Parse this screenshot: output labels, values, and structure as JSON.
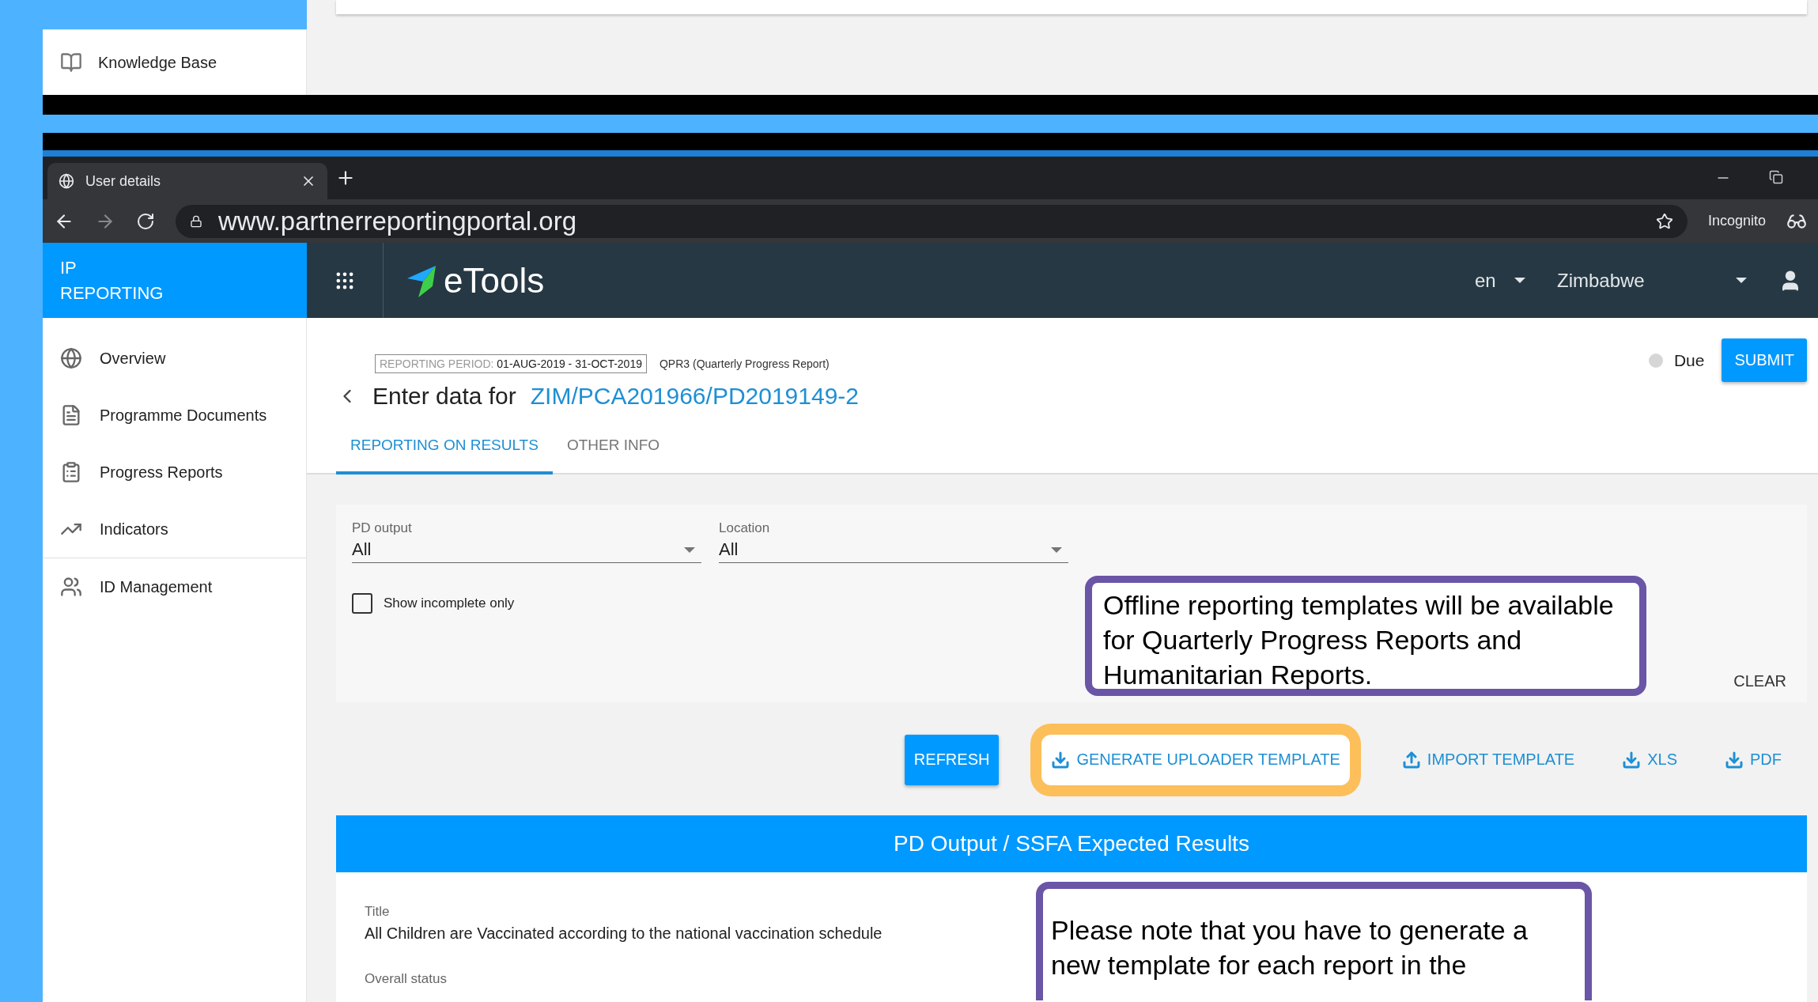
{
  "background_window": {
    "sidebar_items": [
      {
        "label": "Knowledge Base"
      }
    ]
  },
  "browser": {
    "tab": {
      "title": "User details"
    },
    "url": "www.partnerreportingportal.org",
    "profile": "Incognito"
  },
  "app_header": {
    "brand_line_1": "IP",
    "brand_line_2": "REPORTING",
    "logo": "eTools",
    "language": "en",
    "country": "Zimbabwe"
  },
  "sidebar": {
    "items": [
      {
        "label": "Overview"
      },
      {
        "label": "Programme Documents"
      },
      {
        "label": "Progress Reports"
      },
      {
        "label": "Indicators"
      }
    ],
    "secondary_items": [
      {
        "label": "ID Management"
      }
    ]
  },
  "report": {
    "period_label": "REPORTING PERIOD:",
    "period": "01-AUG-2019 - 31-OCT-2019",
    "report_type": "QPR3 (Quarterly Progress Report)",
    "title_prefix": "Enter data for",
    "reference": "ZIM/PCA201966/PD2019149-2",
    "status": "Due",
    "submit": "SUBMIT"
  },
  "tabs": [
    {
      "label": "REPORTING ON RESULTS",
      "selected": true
    },
    {
      "label": "OTHER INFO",
      "selected": false
    }
  ],
  "filters": {
    "fields": [
      {
        "label": "PD output",
        "value": "All"
      },
      {
        "label": "Location",
        "value": "All"
      }
    ],
    "checkbox": {
      "label": "Show incomplete only",
      "checked": false
    },
    "clear": "CLEAR"
  },
  "actions": [
    {
      "label": "REFRESH",
      "kind": "raised",
      "highlighted": false
    },
    {
      "label": "GENERATE UPLOADER TEMPLATE",
      "kind": "download",
      "highlighted": true
    },
    {
      "label": "IMPORT TEMPLATE",
      "kind": "upload",
      "highlighted": false
    },
    {
      "label": "XLS",
      "kind": "download",
      "highlighted": false
    },
    {
      "label": "PDF",
      "kind": "download",
      "highlighted": false
    }
  ],
  "results_section": {
    "heading": "PD Output / SSFA Expected Results",
    "fields": [
      {
        "label": "Title",
        "value": "All Children are Vaccinated according to the national vaccination schedule"
      },
      {
        "label": "Overall status"
      }
    ]
  },
  "callouts": [
    {
      "text": "Offline reporting templates will be available for Quarterly Progress Reports and Humanitarian Reports."
    },
    {
      "text": "Please note that you have to generate a new template for each report in the"
    }
  ]
}
